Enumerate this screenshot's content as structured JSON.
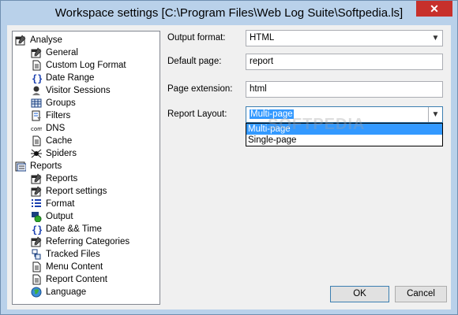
{
  "window": {
    "title": "Workspace settings [C:\\Program Files\\Web Log Suite\\Softpedia.ls]",
    "close_glyph": "✕"
  },
  "tree": {
    "groups": [
      {
        "label": "Analyse",
        "icon": "settings-window-icon",
        "items": [
          {
            "label": "General",
            "icon": "settings-window-icon"
          },
          {
            "label": "Custom Log Format",
            "icon": "document-icon"
          },
          {
            "label": "Date Range",
            "icon": "braces-icon"
          },
          {
            "label": "Visitor Sessions",
            "icon": "visitor-icon"
          },
          {
            "label": "Groups",
            "icon": "grid-icon"
          },
          {
            "label": "Filters",
            "icon": "filter-icon"
          },
          {
            "label": "DNS",
            "icon": "com-icon"
          },
          {
            "label": "Cache",
            "icon": "document-icon"
          },
          {
            "label": "Spiders",
            "icon": "spider-icon"
          }
        ]
      },
      {
        "label": "Reports",
        "icon": "reports-icon",
        "items": [
          {
            "label": "Reports",
            "icon": "settings-window-icon"
          },
          {
            "label": "Report settings",
            "icon": "settings-window-icon"
          },
          {
            "label": "Format",
            "icon": "list-icon"
          },
          {
            "label": "Output",
            "icon": "output-icon"
          },
          {
            "label": "Date && Time",
            "icon": "braces-icon"
          },
          {
            "label": "Referring Categories",
            "icon": "settings-window-icon"
          },
          {
            "label": "Tracked Files",
            "icon": "tracked-files-icon"
          },
          {
            "label": "Menu Content",
            "icon": "document-icon"
          },
          {
            "label": "Report Content",
            "icon": "document-icon"
          },
          {
            "label": "Language",
            "icon": "globe-icon"
          }
        ]
      }
    ]
  },
  "form": {
    "output_format": {
      "label": "Output format:",
      "value": "HTML"
    },
    "default_page": {
      "label": "Default page:",
      "value": "report"
    },
    "page_extension": {
      "label": "Page extension:",
      "value": "html"
    },
    "report_layout": {
      "label": "Report Layout:",
      "value": "Multi-page",
      "options": [
        "Multi-page",
        "Single-page"
      ],
      "highlighted": "Multi-page"
    }
  },
  "buttons": {
    "ok": "OK",
    "cancel": "Cancel"
  },
  "watermark": "SOFTPEDIA"
}
